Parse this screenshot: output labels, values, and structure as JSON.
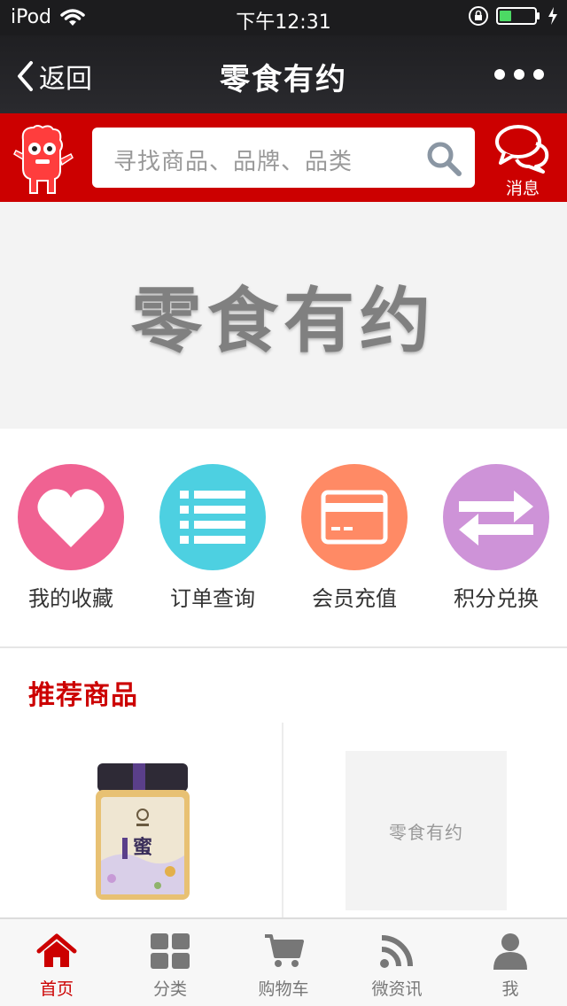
{
  "status_bar": {
    "carrier": "iPod",
    "time": "下午12:31",
    "battery_level": 0.35
  },
  "nav": {
    "back_label": "返回",
    "title": "零食有约"
  },
  "search": {
    "placeholder": "寻找商品、品牌、品类",
    "message_label": "消息"
  },
  "banner": {
    "text": "零食有约"
  },
  "quick_actions": [
    {
      "label": "我的收藏",
      "icon": "heart-icon",
      "color": "#f06292"
    },
    {
      "label": "订单查询",
      "icon": "list-icon",
      "color": "#4dd0e1"
    },
    {
      "label": "会员充值",
      "icon": "card-icon",
      "color": "#ff8a65"
    },
    {
      "label": "积分兑换",
      "icon": "exchange-icon",
      "color": "#ce93d8"
    }
  ],
  "recommend": {
    "title": "推荐商品",
    "placeholder_text": "零食有约"
  },
  "tabs": [
    {
      "label": "首页",
      "icon": "home-icon",
      "active": true
    },
    {
      "label": "分类",
      "icon": "grid-icon",
      "active": false
    },
    {
      "label": "购物车",
      "icon": "cart-icon",
      "active": false
    },
    {
      "label": "微资讯",
      "icon": "rss-icon",
      "active": false
    },
    {
      "label": "我",
      "icon": "user-icon",
      "active": false
    }
  ],
  "colors": {
    "brand_red": "#cc0000",
    "nav_dark": "#1f1f22",
    "tab_active": "#cc0000",
    "tab_inactive": "#777777"
  }
}
